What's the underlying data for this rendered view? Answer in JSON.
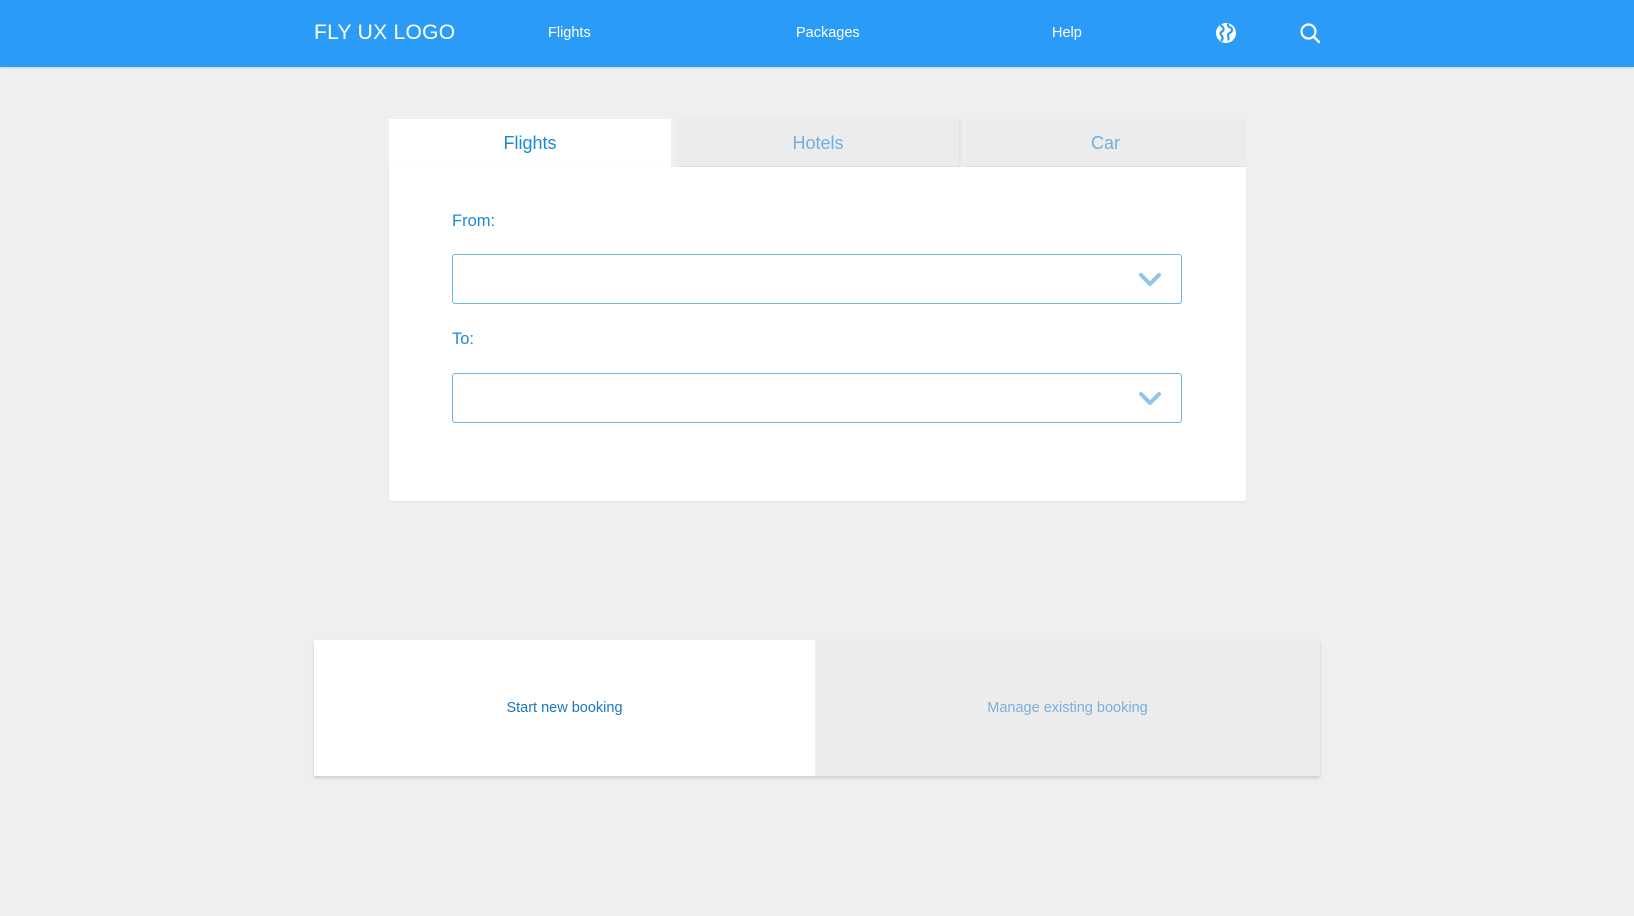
{
  "header": {
    "logo": "FLY UX LOGO",
    "nav": {
      "flights": "Flights",
      "packages": "Packages",
      "help": "Help"
    },
    "icons": [
      "globe-icon",
      "search-icon"
    ]
  },
  "search_card": {
    "tabs": {
      "flights": "Flights",
      "hotels": "Hotels",
      "car": "Car"
    },
    "active_tab": "Flights",
    "from": {
      "label": "From:",
      "value": ""
    },
    "to": {
      "label": "To:",
      "value": ""
    }
  },
  "booking": {
    "start_new": "Start new booking",
    "manage_existing": "Manage existing booking"
  },
  "colors": {
    "brand": "#2a9bf7",
    "accent_text": "#1a8ad6",
    "inactive_text": "#6fb0e0",
    "background": "#eeefef"
  }
}
